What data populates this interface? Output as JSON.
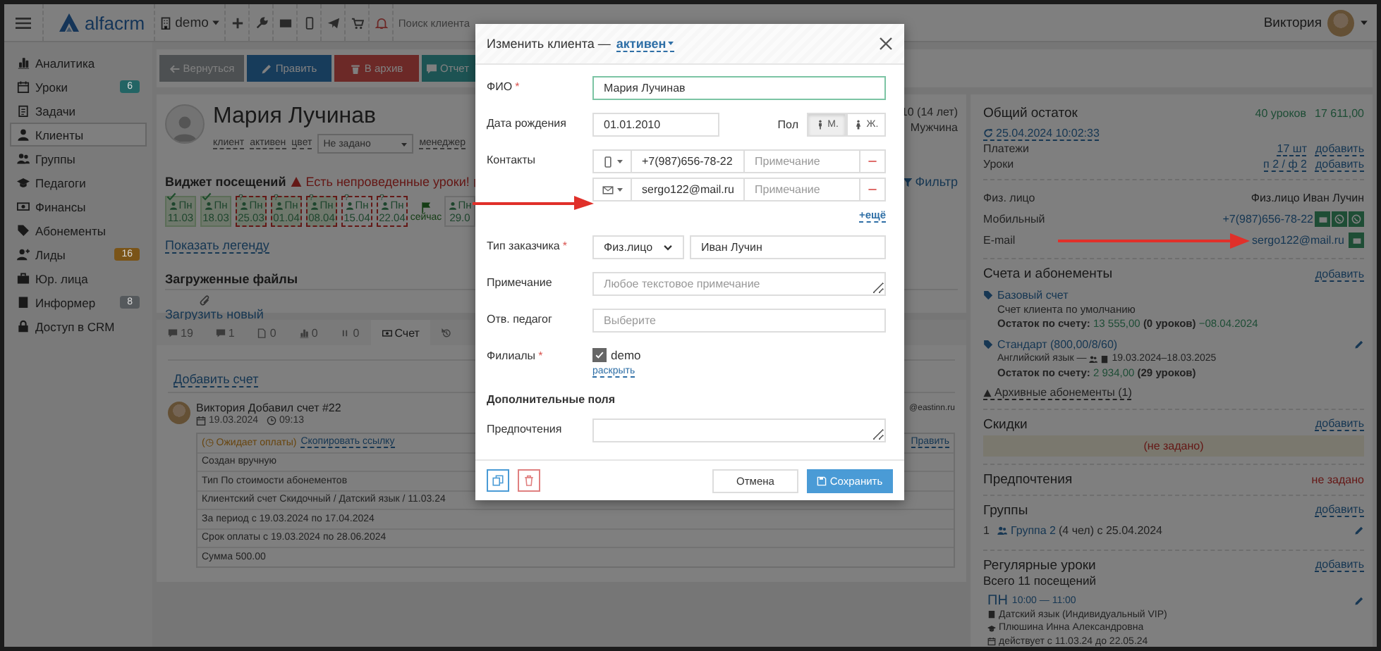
{
  "topbar": {
    "logo": "alfacrm",
    "branch": "demo",
    "search": {
      "placeholder": "Поиск клиента"
    },
    "user": "Виктория"
  },
  "sidebar": {
    "items": [
      {
        "label": "Аналитика",
        "selected": false
      },
      {
        "label": "Уроки",
        "selected": false,
        "badge": "6",
        "color": "#236464"
      },
      {
        "label": "Задачи",
        "selected": false
      },
      {
        "label": "Клиенты",
        "selected": true
      },
      {
        "label": "Группы",
        "selected": false
      },
      {
        "label": "Педагоги",
        "selected": false
      },
      {
        "label": "Финансы",
        "selected": false
      },
      {
        "label": "Абонементы",
        "selected": false
      },
      {
        "label": "Лиды",
        "selected": false,
        "badge": "16",
        "color": "#7a5418"
      },
      {
        "label": "Юр. лица",
        "selected": false
      },
      {
        "label": "Информер",
        "selected": false,
        "badge": "8",
        "color": "#55595c"
      },
      {
        "label": "Доступ в CRM",
        "selected": false
      }
    ]
  },
  "actions": [
    {
      "kind": "back",
      "label": "Вернуться"
    },
    {
      "kind": "edit",
      "label": "Править"
    },
    {
      "kind": "archive",
      "label": "В архив"
    },
    {
      "kind": "report",
      "label": "Отчет"
    }
  ],
  "client": {
    "name": "Мария Лучинав",
    "tags": [
      "клиент",
      "активен",
      "цвет"
    ],
    "manager_select": "Не задано",
    "manager_label": "менеджер",
    "birth": "10 (14 лет)",
    "gender": "Мужчина"
  },
  "visits": {
    "title": "Виджет посещений",
    "warning": "Есть непроведенные уроки!",
    "filter": "Фильтр",
    "legend_link": "Показать легенду",
    "tiles": [
      {
        "kind": "lesson",
        "checked": true,
        "filled": true,
        "warning": false,
        "day": "Пн",
        "date": "11.03"
      },
      {
        "kind": "lesson",
        "checked": true,
        "filled": true,
        "warning": false,
        "day": "Пн",
        "date": "18.03"
      },
      {
        "kind": "lesson",
        "checked": false,
        "filled": true,
        "warning": true,
        "mark": "?",
        "day": "Пн",
        "date": "25.03"
      },
      {
        "kind": "lesson",
        "checked": false,
        "filled": true,
        "warning": true,
        "mark": "?",
        "day": "Пн",
        "date": "01.04"
      },
      {
        "kind": "lesson",
        "checked": false,
        "filled": true,
        "warning": true,
        "mark": "?",
        "day": "Пн",
        "date": "08.04"
      },
      {
        "kind": "lesson",
        "checked": false,
        "filled": false,
        "warning": true,
        "mark": "?",
        "day": "Пн",
        "date": "15.04"
      },
      {
        "kind": "lesson",
        "checked": false,
        "filled": false,
        "warning": true,
        "mark": "?",
        "day": "Пн",
        "date": "22.04"
      },
      {
        "kind": "now",
        "label": "сейчас"
      },
      {
        "kind": "lesson",
        "checked": false,
        "filled": false,
        "warning": false,
        "day": "Пн",
        "date": "29.0"
      }
    ]
  },
  "files": {
    "title": "Загруженные файлы",
    "upload_link": "Загрузить новый"
  },
  "tabs": [
    {
      "label": "19",
      "selected": false
    },
    {
      "label": "1",
      "selected": false
    },
    {
      "label": "0",
      "selected": false
    },
    {
      "label": "0",
      "selected": false
    },
    {
      "label": "0",
      "selected": false
    },
    {
      "label": "Счет",
      "selected": true
    },
    {
      "selected": false
    }
  ],
  "invoice": {
    "add_link": "Добавить счет",
    "author": "Виктория",
    "action": "Добавил счет #22",
    "date": "19.03.2024",
    "time": "09:13",
    "email_cut": "@eastinn.ru",
    "status": "(◷ Ожидает оплаты)",
    "copy_link": "Скопировать ссылку",
    "edit_link": "Править",
    "rows": [
      "Создан вручную",
      "Тип По стоимости абонементов",
      "Клиентский счет Скидочный / Датский язык / 11.03.24",
      "За период с 19.03.2024 по 17.04.2024",
      "Срок оплаты с 19.03.2024 по 28.06.2024",
      "Сумма 500.00"
    ]
  },
  "summary": {
    "title": "Общий остаток",
    "lessons": "40 уроков",
    "amount": "17 611,00",
    "updated": "25.04.2024 10:02:33",
    "rows": [
      {
        "label": "Платежи",
        "value": "17 шт",
        "action": "добавить"
      },
      {
        "label": "Уроки",
        "value": "п 2 / ф 2",
        "action": "добавить"
      }
    ]
  },
  "contacts": [
    {
      "kind": "text",
      "label": "Физ. лицо",
      "value": "Физ.лицо Иван Лучин"
    },
    {
      "kind": "phone",
      "label": "Мобильный",
      "value": "+7(987)656-78-22"
    },
    {
      "kind": "email",
      "label": "E-mail",
      "value": "sergo122@mail.ru"
    }
  ],
  "accounts": {
    "title": "Счета и абонементы",
    "action": "добавить",
    "archive_link": "Архивные абонементы (1)",
    "items": [
      {
        "kind": "account",
        "name": "Базовый счет",
        "note": "Счет клиента по умолчанию",
        "balance_label": "Остаток по счету:",
        "balance": "13 555,00",
        "extra": "(0 уроков)",
        "date": "−08.04.2024"
      },
      {
        "kind": "subscription",
        "name": "Стандарт (800,00/8/60)",
        "note": "Английский язык —",
        "period": "19.03.2024–18.03.2025",
        "balance_label": "Остаток по счету:",
        "balance": "2 934,00",
        "extra": "(29 уроков)"
      }
    ]
  },
  "discounts": {
    "title": "Скидки",
    "action": "добавить",
    "empty": "(не задано)"
  },
  "preferences": {
    "title": "Предпочтения",
    "value": "не задано"
  },
  "groups": {
    "title": "Группы",
    "action": "добавить",
    "items": [
      {
        "index": "1",
        "name": "Группа 2",
        "note": "(4 чел) с 25.04.2024"
      }
    ]
  },
  "regular": {
    "title": "Регулярные уроки",
    "action": "добавить",
    "total": "Всего 11 посещений",
    "items": [
      {
        "day": "ПН",
        "time": "10:00 — 11:00",
        "subject": "Датский язык (Индивидуальный VIP)",
        "teacher": "Плюшина Инна Александровна",
        "period": "действует с 11.03.24 до 22.05.24"
      }
    ]
  },
  "modal": {
    "title": "Изменить клиента —",
    "status": "активен",
    "cancel": "Отмена",
    "save": "Сохранить",
    "fields": [
      {
        "kind": "text",
        "label": "ФИО",
        "required": "*",
        "value": "Мария Лучинав"
      },
      {
        "kind": "date_gender",
        "label": "Дата рождения",
        "value": "01.01.2010",
        "gender_label": "Пол",
        "options": [
          {
            "label": "М.",
            "selected": true
          },
          {
            "label": "Ж.",
            "selected": false
          }
        ]
      },
      {
        "kind": "contacts",
        "label": "Контакты",
        "more": "+ещё",
        "items": [
          {
            "kind": "phone",
            "value": "+7(987)656-78-22",
            "placeholder": "Примечание"
          },
          {
            "kind": "email",
            "value": "sergo122@mail.ru",
            "placeholder": "Примечание"
          }
        ]
      },
      {
        "kind": "customer",
        "label": "Тип заказчика",
        "required": "*",
        "select": "Физ.лицо",
        "value": "Иван Лучин"
      },
      {
        "kind": "textarea",
        "label": "Примечание",
        "placeholder": "Любое текстовое примечание"
      },
      {
        "kind": "select",
        "label": "Отв. педагог",
        "placeholder": "Выберите"
      },
      {
        "kind": "checks",
        "label": "Филиалы",
        "required": "*",
        "link": "раскрыть",
        "items": [
          {
            "label": "demo",
            "checked": true
          }
        ]
      },
      {
        "kind": "heading",
        "label": "Дополнительные поля"
      },
      {
        "kind": "textarea",
        "label": "Предпочтения"
      }
    ]
  }
}
